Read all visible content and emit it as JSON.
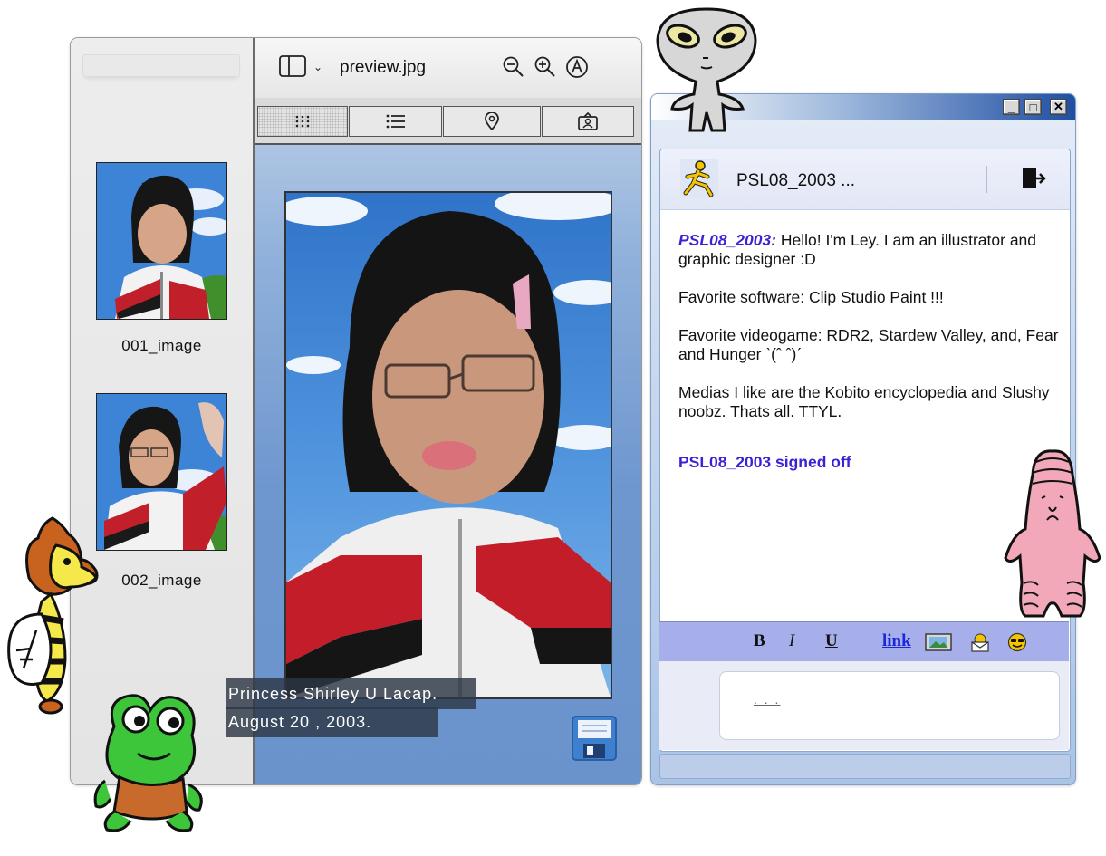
{
  "preview": {
    "title": "preview.jpg",
    "thumbnails": [
      {
        "label": "001_image"
      },
      {
        "label": "002_image"
      }
    ],
    "view_tabs": [
      "grid-view",
      "list-view",
      "location-view",
      "person-view"
    ],
    "caption_lines": [
      "Princess Shirley U Lacap.",
      "August 20 , 2003."
    ]
  },
  "im": {
    "buddy_name": "PSL08_2003 ...",
    "messages": [
      {
        "sender": "PSL08_2003:",
        "text": " Hello! I'm Ley. I am an illustrator and graphic designer :D"
      },
      {
        "text": "Favorite software: Clip Studio Paint !!!"
      },
      {
        "text": "Favorite videogame: RDR2, Stardew Valley, and, Fear and Hunger ˋ(ˆ ˆ)ˊ"
      },
      {
        "text": "Medias I like are the Kobito encyclopedia and Slushy noobz. Thats all. TTYL."
      }
    ],
    "signoff": "PSL08_2003 signed off",
    "format": {
      "bold": "B",
      "italic": "I",
      "underline": "U",
      "link": "link"
    },
    "input_value": ". . ."
  },
  "colors": {
    "accent": "#3a22d6",
    "toolbar_blue": "#1f4fa3",
    "format_bar": "#a7afea"
  }
}
